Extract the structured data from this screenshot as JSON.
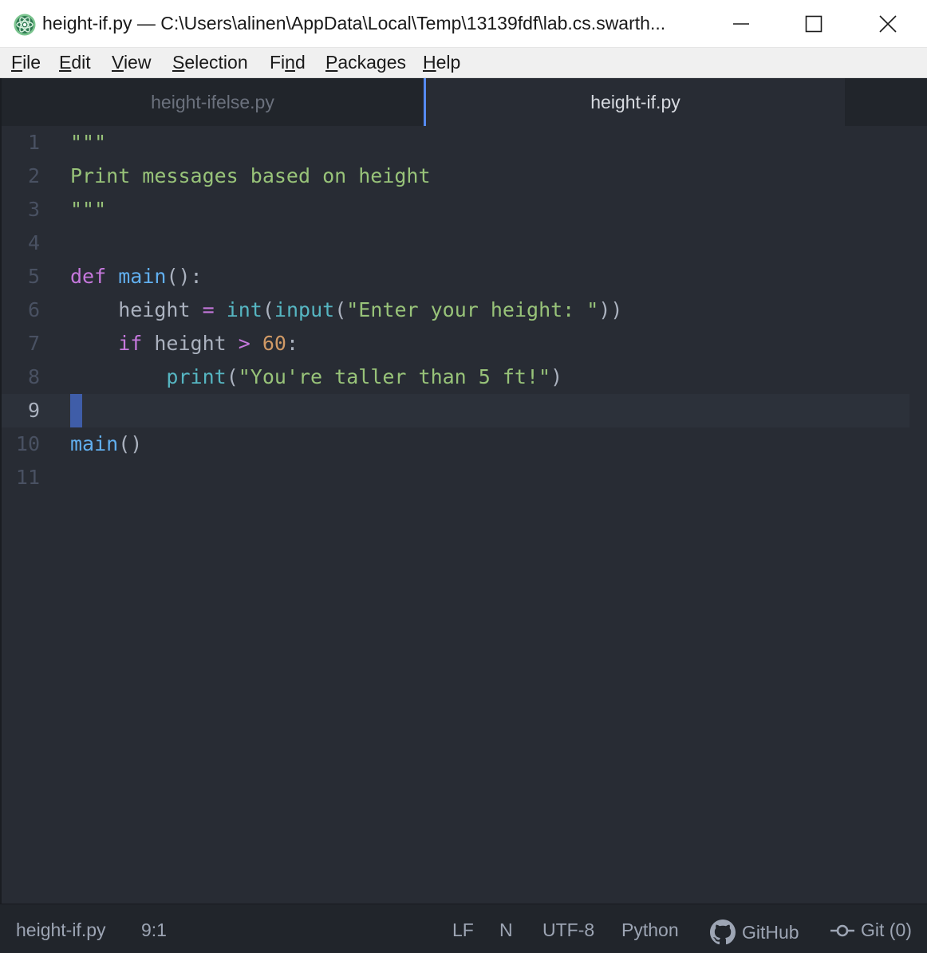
{
  "window": {
    "title": "height-if.py — C:\\Users\\alinen\\AppData\\Local\\Temp\\13139fdf\\lab.cs.swarth...",
    "icon": "atom-icon",
    "controls": {
      "minimize": "minimize-icon",
      "maximize": "maximize-icon",
      "close": "close-icon"
    }
  },
  "menu": [
    {
      "accel": "F",
      "rest": "ile"
    },
    {
      "accel": "E",
      "rest": "dit"
    },
    {
      "accel": "V",
      "rest": "iew"
    },
    {
      "accel": "S",
      "rest": "election"
    },
    {
      "pre": "Fi",
      "accel": "n",
      "rest": "d"
    },
    {
      "accel": "P",
      "rest": "ackages"
    },
    {
      "accel": "H",
      "rest": "elp"
    }
  ],
  "tabs": [
    {
      "label": "height-ifelse.py",
      "active": false
    },
    {
      "label": "height-if.py",
      "active": true
    }
  ],
  "editor": {
    "cursor_line": 9,
    "lines": [
      {
        "num": "1",
        "tokens": [
          {
            "t": "\"\"\"",
            "c": "str"
          }
        ]
      },
      {
        "num": "2",
        "tokens": [
          {
            "t": "Print messages based on height",
            "c": "str"
          }
        ]
      },
      {
        "num": "3",
        "tokens": [
          {
            "t": "\"\"\"",
            "c": "str"
          }
        ]
      },
      {
        "num": "4",
        "tokens": []
      },
      {
        "num": "5",
        "tokens": [
          {
            "t": "def",
            "c": "kw"
          },
          {
            "t": " ",
            "c": "var"
          },
          {
            "t": "main",
            "c": "fn"
          },
          {
            "t": "():",
            "c": "var"
          }
        ]
      },
      {
        "num": "6",
        "tokens": [
          {
            "t": "    height ",
            "c": "var"
          },
          {
            "t": "=",
            "c": "op"
          },
          {
            "t": " ",
            "c": "var"
          },
          {
            "t": "int",
            "c": "bi"
          },
          {
            "t": "(",
            "c": "var"
          },
          {
            "t": "input",
            "c": "bi"
          },
          {
            "t": "(",
            "c": "var"
          },
          {
            "t": "\"Enter your height: \"",
            "c": "str"
          },
          {
            "t": "))",
            "c": "var"
          }
        ]
      },
      {
        "num": "7",
        "tokens": [
          {
            "t": "    ",
            "c": "var"
          },
          {
            "t": "if",
            "c": "kw"
          },
          {
            "t": " height ",
            "c": "var"
          },
          {
            "t": ">",
            "c": "op"
          },
          {
            "t": " ",
            "c": "var"
          },
          {
            "t": "60",
            "c": "num"
          },
          {
            "t": ":",
            "c": "var"
          }
        ]
      },
      {
        "num": "8",
        "tokens": [
          {
            "t": "        ",
            "c": "var"
          },
          {
            "t": "print",
            "c": "bi"
          },
          {
            "t": "(",
            "c": "var"
          },
          {
            "t": "\"You're taller than 5 ft!\"",
            "c": "str"
          },
          {
            "t": ")",
            "c": "var"
          }
        ]
      },
      {
        "num": "9",
        "tokens": []
      },
      {
        "num": "10",
        "tokens": [
          {
            "t": "main",
            "c": "fn"
          },
          {
            "t": "()",
            "c": "var"
          }
        ]
      },
      {
        "num": "11",
        "tokens": []
      }
    ]
  },
  "status": {
    "file": "height-if.py",
    "position": "9:1",
    "line_ending": "LF",
    "indicator": "N",
    "encoding": "UTF-8",
    "grammar": "Python",
    "github": "GitHub",
    "git": "Git (0)",
    "github_icon": "github-icon",
    "git_icon": "git-commit-icon"
  },
  "colors": {
    "background": "#282c34",
    "accent": "#568af2",
    "cursor": "#3f5da8",
    "string": "#98c379",
    "keyword": "#c678dd",
    "function": "#61afef",
    "builtin": "#56b6c2",
    "number": "#d19a66"
  }
}
